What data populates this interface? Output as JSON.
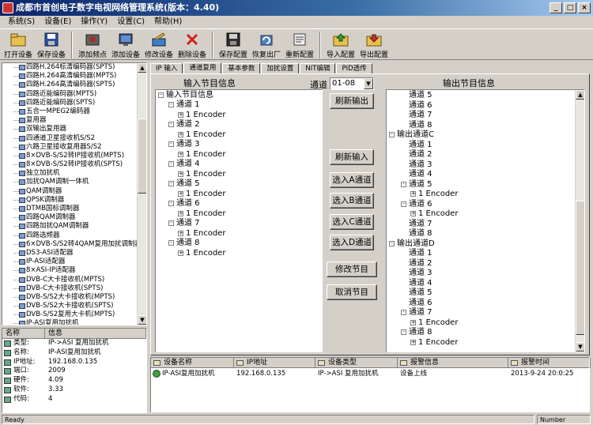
{
  "window": {
    "title": "成都市首创电子数字电视网络管理系统(版本：4.40)"
  },
  "menu": [
    "系统(S)",
    "设备(E)",
    "操作(Y)",
    "设置(C)",
    "帮助(H)"
  ],
  "toolbar": [
    {
      "label": "打开设备",
      "icon": "open-device-icon"
    },
    {
      "label": "保存设备",
      "icon": "save-device-icon"
    },
    {
      "label": "添加频点",
      "icon": "add-frequency-icon"
    },
    {
      "label": "添加设备",
      "icon": "add-device-icon"
    },
    {
      "label": "修改设备",
      "icon": "edit-device-icon"
    },
    {
      "label": "删除设备",
      "icon": "delete-device-icon"
    },
    {
      "label": "保存配置",
      "icon": "save-config-icon"
    },
    {
      "label": "恢复出厂",
      "icon": "factory-reset-icon"
    },
    {
      "label": "重新配置",
      "icon": "reconfigure-icon"
    },
    {
      "label": "导入配置",
      "icon": "import-config-icon"
    },
    {
      "label": "导出配置",
      "icon": "export-config-icon"
    }
  ],
  "device_tree": [
    "四路H.264标清编码器(SPTS)",
    "四路H.264高清编码器(MPTS)",
    "四路H.264高清编码器(SPTS)",
    "四路近能编码器(MPTS)",
    "四路近能编码器(SPTS)",
    "五合一MPEG2编码器",
    "复用器",
    "双输出复用器",
    "四通道卫星接收机S/S2",
    "六路卫星接收复用器S/S2",
    "8×DVB-S/S2转IP接收机(MPTS)",
    "8×DVB-S/S2转IP接收机(SPTS)",
    "独立加扰机",
    "加扰QAM调制一体机",
    "QAM调制器",
    "QPSK调制器",
    "DTMB国标调制器",
    "四路QAM调制器",
    "四路加扰QAM调制器",
    "四路选频器",
    "6×DVB-S/S2转4QAM复用加扰调制器",
    "DS3-ASI适配器",
    "IP-ASI适配器",
    "8×ASI-IP适配器",
    "DVB-C大卡接收机(MPTS)",
    "DVB-C大卡接收机(SPTS)",
    "DVB-S/S2大卡接收机(MPTS)",
    "DVB-S/S2大卡接收机(SPTS)",
    "DVB-S/S2复用大卡机(MPTS)",
    "IP-ASI复用加扰机"
  ],
  "info_panel": {
    "col_name": "名称",
    "col_info": "信息",
    "rows": [
      {
        "k": "类型:",
        "v": "IP->ASI 复用加扰机"
      },
      {
        "k": "名称:",
        "v": "IP-ASI复用加扰机"
      },
      {
        "k": "IP地址:",
        "v": "192.168.0.135"
      },
      {
        "k": "端口:",
        "v": "2009"
      },
      {
        "k": "硬件:",
        "v": "4.09"
      },
      {
        "k": "软件:",
        "v": "3.33"
      },
      {
        "k": "代码:",
        "v": "4"
      }
    ]
  },
  "tabs": [
    "IP 输入",
    "通道复用",
    "基本参数",
    "加扰设置",
    "NIT编辑",
    "PID透传"
  ],
  "input_section": {
    "label": "输入节目信息",
    "root": "输入节目信息",
    "channels": [
      {
        "name": "通道 1",
        "child": "1 Encoder"
      },
      {
        "name": "通道 2",
        "child": "1 Encoder"
      },
      {
        "name": "通道 3",
        "child": "1 Encoder"
      },
      {
        "name": "通道 4",
        "child": "1 Encoder"
      },
      {
        "name": "通道 5",
        "child": "1 Encoder"
      },
      {
        "name": "通道 6",
        "child": "1 Encoder"
      },
      {
        "name": "通道 7",
        "child": "1 Encoder"
      },
      {
        "name": "通道 8",
        "child": "1 Encoder"
      }
    ]
  },
  "channel_select": {
    "label": "通道",
    "value": "01-08"
  },
  "buttons": {
    "refresh_output": "刷新输出",
    "refresh_input": "刷新输入",
    "select_a": "选入A通道",
    "select_b": "选入B通道",
    "select_c": "选入C通道",
    "select_d": "选入D通道",
    "modify": "修改节目",
    "cancel": "取消节目"
  },
  "output_section": {
    "label": "输出节目信息",
    "rows": [
      {
        "t": "通道 5",
        "lvl": 1
      },
      {
        "t": "通道 6",
        "lvl": 1
      },
      {
        "t": "通道 7",
        "lvl": 1
      },
      {
        "t": "通道 8",
        "lvl": 1
      },
      {
        "t": "输出通道C",
        "lvl": 0,
        "pm": "-"
      },
      {
        "t": "通道 1",
        "lvl": 1
      },
      {
        "t": "通道 2",
        "lvl": 1
      },
      {
        "t": "通道 3",
        "lvl": 1
      },
      {
        "t": "通道 4",
        "lvl": 1
      },
      {
        "t": "通道 5",
        "lvl": 1,
        "pm": "-"
      },
      {
        "t": "1 Encoder",
        "lvl": 2,
        "pm": "+"
      },
      {
        "t": "通道 6",
        "lvl": 1,
        "pm": "-"
      },
      {
        "t": "1 Encoder",
        "lvl": 2,
        "pm": "+"
      },
      {
        "t": "通道 7",
        "lvl": 1
      },
      {
        "t": "通道 8",
        "lvl": 1
      },
      {
        "t": "输出通道D",
        "lvl": 0,
        "pm": "-"
      },
      {
        "t": "通道 1",
        "lvl": 1
      },
      {
        "t": "通道 2",
        "lvl": 1
      },
      {
        "t": "通道 3",
        "lvl": 1
      },
      {
        "t": "通道 4",
        "lvl": 1
      },
      {
        "t": "通道 5",
        "lvl": 1
      },
      {
        "t": "通道 6",
        "lvl": 1
      },
      {
        "t": "通道 7",
        "lvl": 1,
        "pm": "-"
      },
      {
        "t": "1 Encoder",
        "lvl": 2,
        "pm": "+"
      },
      {
        "t": "通道 8",
        "lvl": 1,
        "pm": "-"
      },
      {
        "t": "1 Encoder",
        "lvl": 2,
        "pm": "+"
      }
    ]
  },
  "alarm_table": {
    "headers": [
      "设备名称",
      "IP地址",
      "设备类型",
      "报警信息",
      "报警时间"
    ],
    "rows": [
      [
        "IP-ASI复用加扰机",
        "192.168.0.135",
        "IP->ASI 复用加扰机",
        "设备上线",
        "2013-9-24 20:0:25"
      ]
    ]
  },
  "status": {
    "left": "Ready",
    "right": "Number"
  }
}
